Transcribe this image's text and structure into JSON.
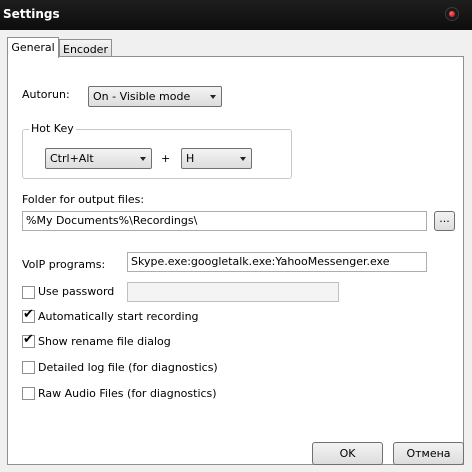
{
  "window": {
    "title": "Settings"
  },
  "tabs": [
    {
      "label": "General",
      "active": true
    },
    {
      "label": "Encoder",
      "active": false
    }
  ],
  "general": {
    "autorun_label": "Autorun:",
    "autorun_value": "On - Visible mode",
    "hotkey_group_title": "Hot Key",
    "hotkey_modifier": "Ctrl+Alt",
    "hotkey_plus": "+",
    "hotkey_key": "H",
    "folder_label": "Folder for output files:",
    "folder_value": "%My Documents%\\Recordings\\",
    "browse_label": "...",
    "voip_label": "VoIP programs:",
    "voip_value": "Skype.exe:googletalk.exe:YahooMessenger.exe",
    "options": [
      {
        "label": "Use password",
        "checked": false
      },
      {
        "label": "Automatically start recording",
        "checked": true
      },
      {
        "label": "Show rename file dialog",
        "checked": true
      },
      {
        "label": "Detailed log file (for diagnostics)",
        "checked": false
      },
      {
        "label": "Raw Audio Files (for diagnostics)",
        "checked": false
      }
    ],
    "password_value": ""
  },
  "buttons": {
    "ok": "OK",
    "cancel": "Отмена"
  },
  "icons": {
    "close": "close-icon",
    "dropdown": "chevron-down-icon",
    "check": "checkmark-icon"
  },
  "colors": {
    "titlebar": "#141414",
    "close_dot": "#d40000"
  }
}
